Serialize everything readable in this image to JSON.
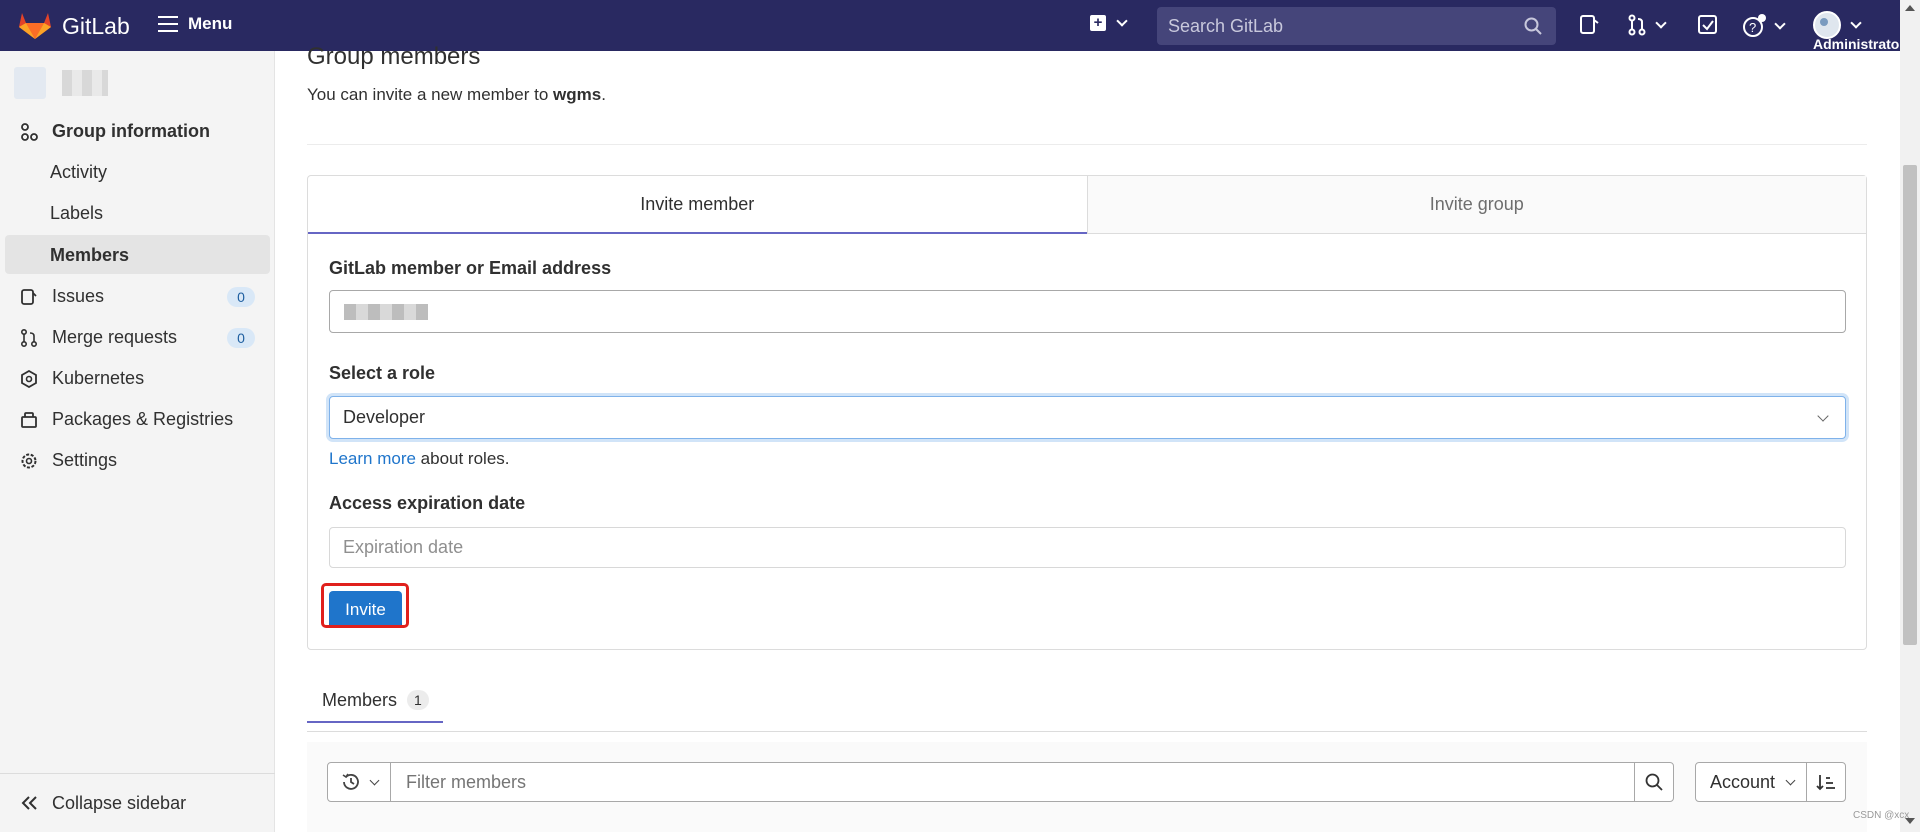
{
  "navbar": {
    "brand": "GitLab",
    "menu_label": "Menu",
    "search_placeholder": "Search GitLab",
    "user_label": "Administrator"
  },
  "sidebar": {
    "section_title": "Group information",
    "items": [
      {
        "label": "Activity"
      },
      {
        "label": "Labels"
      },
      {
        "label": "Members"
      },
      {
        "label": "Issues",
        "badge": "0"
      },
      {
        "label": "Merge requests",
        "badge": "0"
      },
      {
        "label": "Kubernetes"
      },
      {
        "label": "Packages & Registries"
      },
      {
        "label": "Settings"
      }
    ],
    "collapse_label": "Collapse sidebar"
  },
  "main": {
    "title": "Group members",
    "invite_prefix": "You can invite a new member to ",
    "group_name": "wgms",
    "invite_suffix": ".",
    "tabs": [
      {
        "label": "Invite member"
      },
      {
        "label": "Invite group"
      }
    ],
    "member_field_label": "GitLab member or Email address",
    "role_label": "Select a role",
    "role_value": "Developer",
    "learn_more_link": "Learn more",
    "learn_more_suffix": " about roles.",
    "expiration_label": "Access expiration date",
    "expiration_placeholder": "Expiration date",
    "invite_button": "Invite",
    "members_tab_label": "Members",
    "members_count": "1",
    "filter_placeholder": "Filter members",
    "sort_label": "Account"
  },
  "watermark": "CSDN @xcx",
  "colors": {
    "navbar": "#292961",
    "accent": "#1f75cb",
    "highlight": "#e0201c"
  }
}
